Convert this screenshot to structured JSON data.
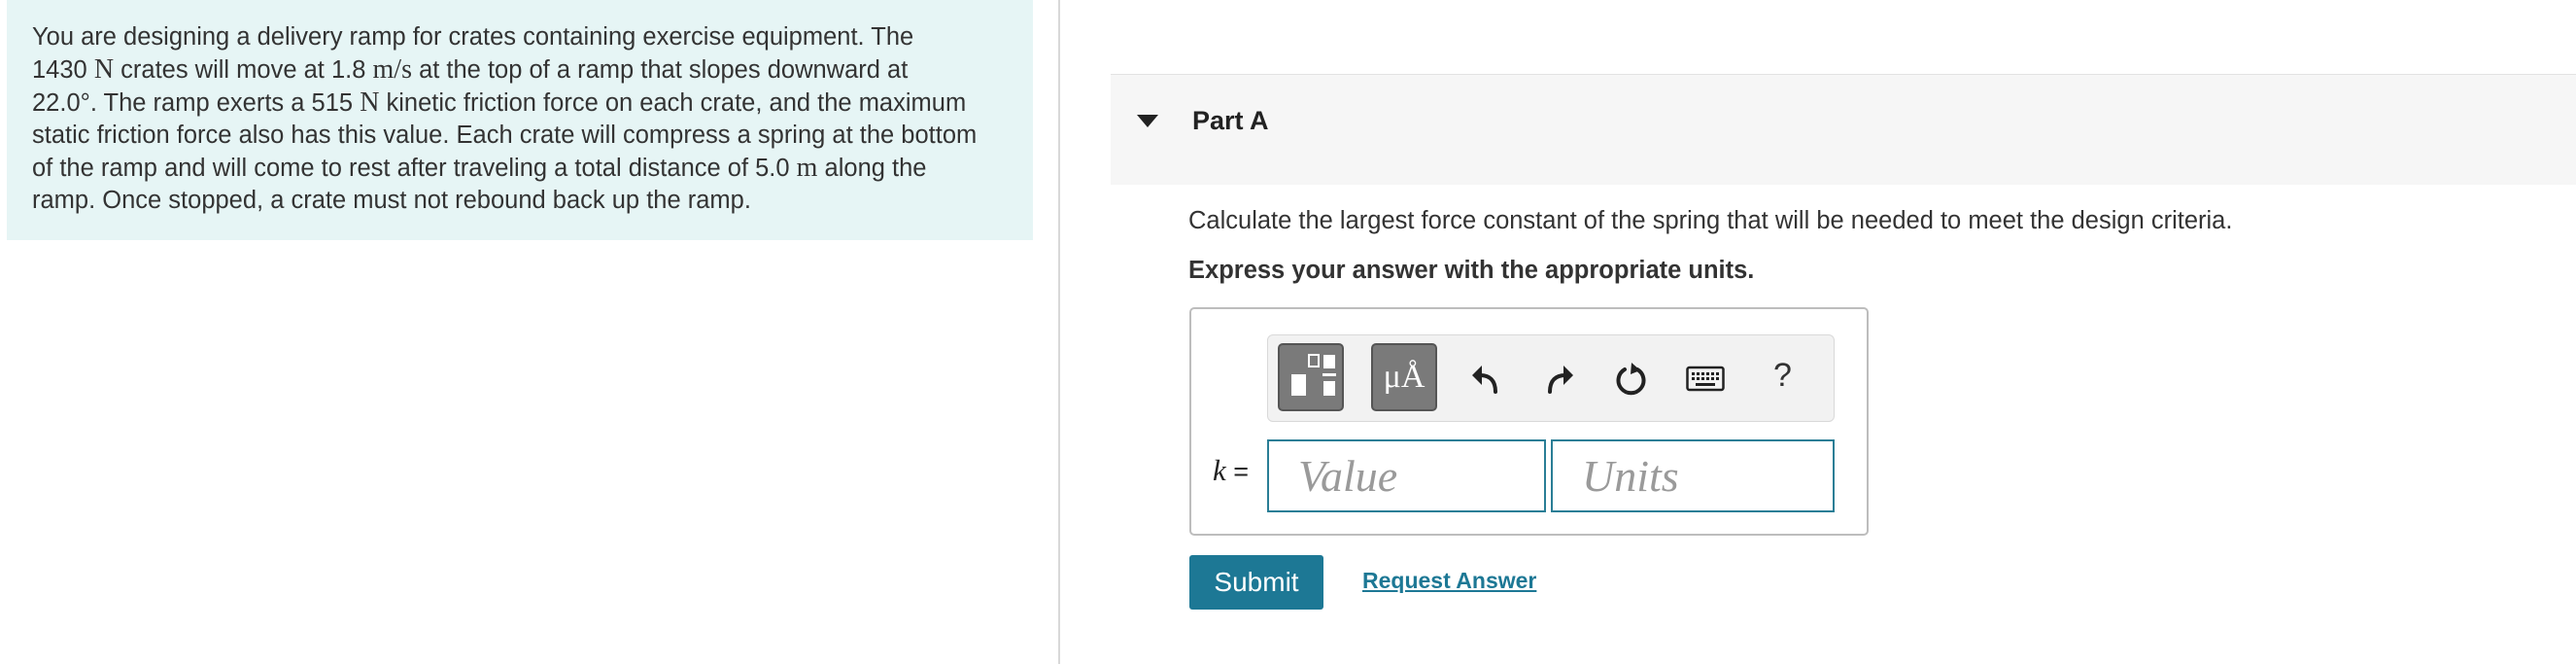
{
  "problem": {
    "s1": "You are designing a delivery ramp for crates containing exercise equipment. The",
    "weight": "1430",
    "unit_N": "N",
    "s2": " crates will move at ",
    "speed": "1.8",
    "unit_ms": "m/s",
    "s3": " at the top of a ramp that slopes downward at",
    "angle": "22.0°",
    "s4": ". The ramp exerts a ",
    "friction": "515",
    "s5": " kinetic friction force on each crate, and the maximum",
    "s6": "static friction force also has this value. Each crate will compress a spring at the bottom",
    "s7": "of the ramp and will come to rest after traveling a total distance of ",
    "distance": "5.0",
    "unit_m": "m",
    "s8": " along the",
    "s9": "ramp. Once stopped, a crate must not rebound back up the ramp."
  },
  "part": {
    "title": "Part A"
  },
  "question": "Calculate the largest force constant of the spring that will be needed to meet the design criteria.",
  "instruction": "Express your answer with the appropriate units.",
  "toolbar": {
    "symbols_label": "μÅ",
    "help_label": "?",
    "icons": [
      "templates-icon",
      "undo-icon",
      "redo-icon",
      "reset-icon",
      "keyboard-icon",
      "help-icon"
    ]
  },
  "answer": {
    "variable": "k",
    "equals": " =",
    "value_placeholder": "Value",
    "units_placeholder": "Units"
  },
  "actions": {
    "submit_label": "Submit",
    "request_label": "Request Answer"
  },
  "colors": {
    "problem_bg": "#e6f5f5",
    "accent": "#1d7895",
    "input_border": "#2a7e96"
  }
}
